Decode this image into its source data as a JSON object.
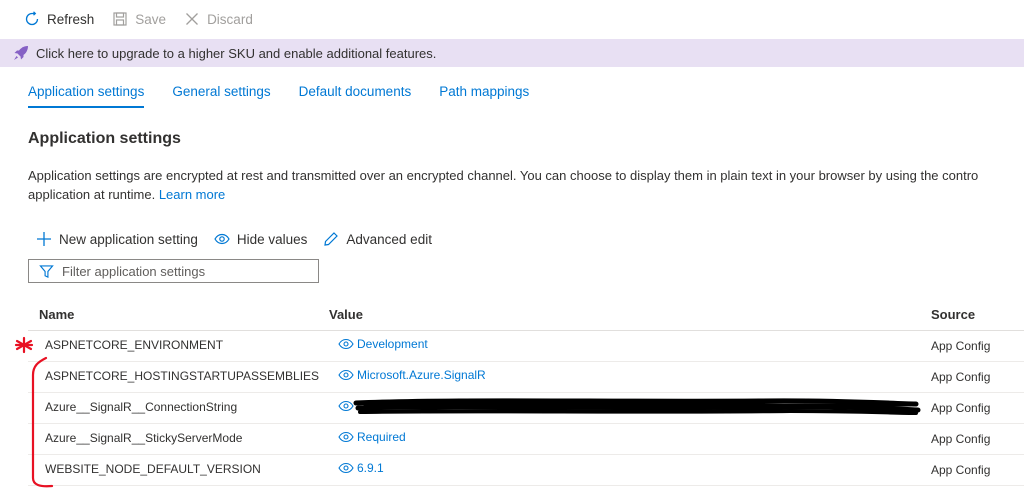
{
  "toolbar": {
    "refresh_label": "Refresh",
    "save_label": "Save",
    "discard_label": "Discard"
  },
  "banner": {
    "text": "Click here to upgrade to a higher SKU and enable additional features."
  },
  "tabs": [
    {
      "label": "Application settings",
      "active": true
    },
    {
      "label": "General settings",
      "active": false
    },
    {
      "label": "Default documents",
      "active": false
    },
    {
      "label": "Path mappings",
      "active": false
    }
  ],
  "section": {
    "title": "Application settings",
    "description_line1": "Application settings are encrypted at rest and transmitted over an encrypted channel. You can choose to display them in plain text in your browser by using the contro",
    "description_line2": "application at runtime.",
    "learn_more": "Learn more"
  },
  "actions": {
    "new_setting": "New application setting",
    "hide_values": "Hide values",
    "advanced_edit": "Advanced edit"
  },
  "filter": {
    "placeholder": "Filter application settings"
  },
  "table": {
    "headers": {
      "name": "Name",
      "value": "Value",
      "source": "Source"
    },
    "rows": [
      {
        "name": "ASPNETCORE_ENVIRONMENT",
        "value": "Development",
        "source": "App Config"
      },
      {
        "name": "ASPNETCORE_HOSTINGSTARTUPASSEMBLIES",
        "value": "Microsoft.Azure.SignalR",
        "source": "App Config"
      },
      {
        "name": "Azure__SignalR__ConnectionString",
        "value": "",
        "source": "App Config"
      },
      {
        "name": "Azure__SignalR__StickyServerMode",
        "value": "Required",
        "source": "App Config"
      },
      {
        "name": "WEBSITE_NODE_DEFAULT_VERSION",
        "value": "6.9.1",
        "source": "App Config"
      }
    ]
  },
  "colors": {
    "accent": "#0078d4",
    "banner_bg": "#e8e0f3",
    "annotation": "#e81123"
  }
}
